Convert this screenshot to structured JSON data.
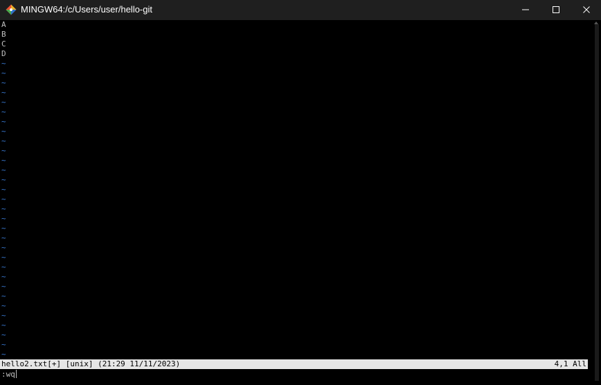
{
  "window": {
    "title": "MINGW64:/c/Users/user/hello-git",
    "icon": "git-bash-icon",
    "controls": [
      "minimize-icon",
      "maximize-icon",
      "close-icon"
    ]
  },
  "editor": {
    "lines": [
      "A",
      "B",
      "C",
      "D"
    ],
    "empty_marker": "~",
    "empty_line_count": 31,
    "status": {
      "left": "hello2.txt[+] [unix] (21:29 11/11/2023)",
      "right": "4,1 All"
    },
    "command": ":wq"
  },
  "colors": {
    "titlebar": "#1f1f1f",
    "background": "#000000",
    "text": "#c0c0c0",
    "tilde": "#3a7bd5",
    "statusline_bg": "#e6e6e6"
  }
}
